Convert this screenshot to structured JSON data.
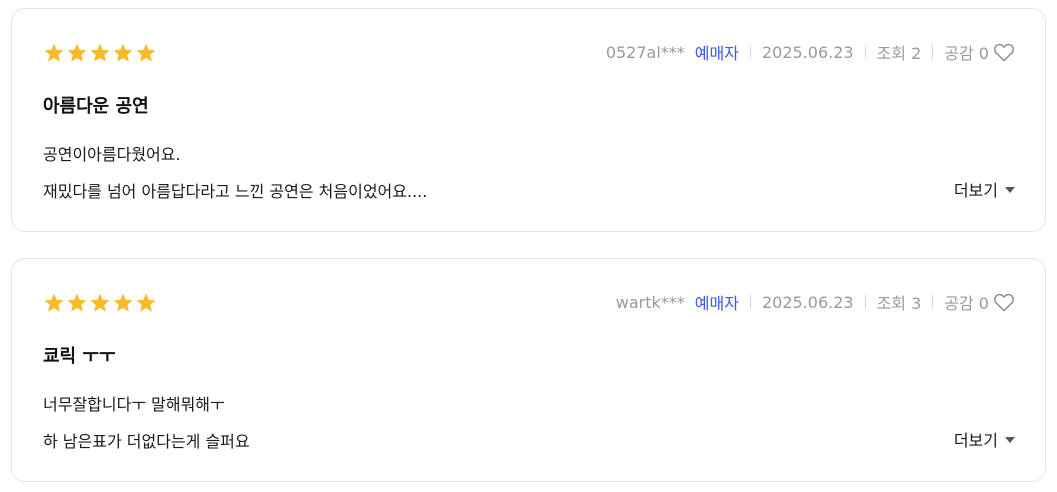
{
  "colors": {
    "star": "#f8b92b",
    "buyer_badge": "#4154f1",
    "meta_text": "#9a9a9a",
    "card_border": "#e4e4e4"
  },
  "reviews": [
    {
      "rating": 5,
      "username": "0527al***",
      "buyer_label": "예매자",
      "date": "2025.06.23",
      "views_label": "조회 2",
      "likes_label": "공감 0",
      "title": "아름다운 공연",
      "line1": "공연이아름다웠어요.",
      "line2": "재밌다를 넘어 아름답다라고 느낀 공연은 처음이었어요....",
      "more_label": "더보기",
      "icons": [
        "star-icon",
        "heart-icon",
        "caret-down-icon"
      ]
    },
    {
      "rating": 5,
      "username": "wartk***",
      "buyer_label": "예매자",
      "date": "2025.06.23",
      "views_label": "조회 3",
      "likes_label": "공감 0",
      "title": "쿄릭 ㅜㅜ",
      "line1": "너무잘합니다ㅜ 말해뭐해ㅜ",
      "line2": "하 남은표가 더없다는게 슬퍼요",
      "more_label": "더보기",
      "icons": [
        "star-icon",
        "heart-icon",
        "caret-down-icon"
      ]
    }
  ]
}
